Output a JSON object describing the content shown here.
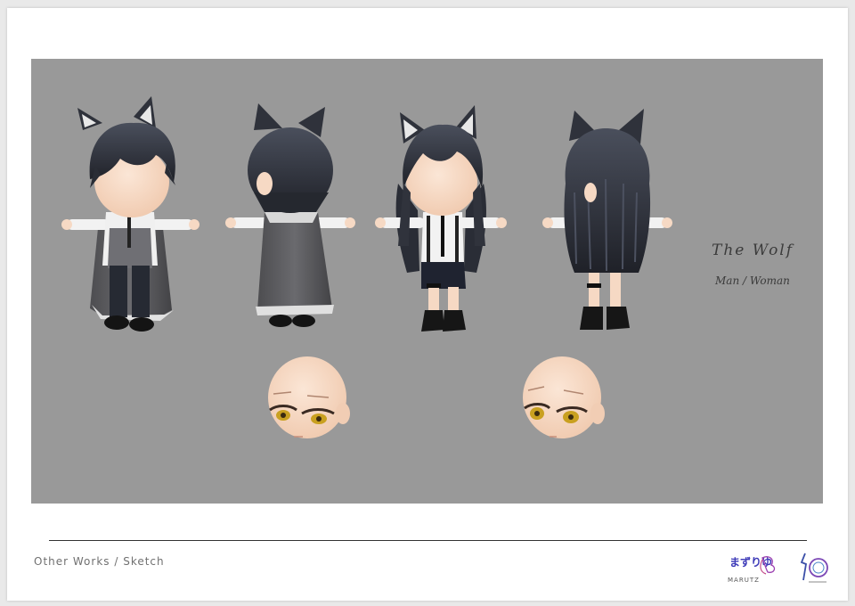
{
  "sheet": {
    "title": "The Wolf",
    "subtitle": "Man / Woman",
    "footer_caption": "Other Works / Sketch"
  },
  "figures": [
    {
      "name": "wolf-man-front"
    },
    {
      "name": "wolf-man-back"
    },
    {
      "name": "wolf-woman-front"
    },
    {
      "name": "wolf-woman-back"
    }
  ],
  "heads": [
    {
      "name": "male-face"
    },
    {
      "name": "female-face"
    }
  ],
  "logos": {
    "marutz_jp": "まずりゆ",
    "marutz_en": "MARUTZ"
  },
  "colors": {
    "canvas": "#999999",
    "hair": "#2b2e36",
    "skin": "#f6d9c4",
    "eyes": "#c9a020"
  }
}
